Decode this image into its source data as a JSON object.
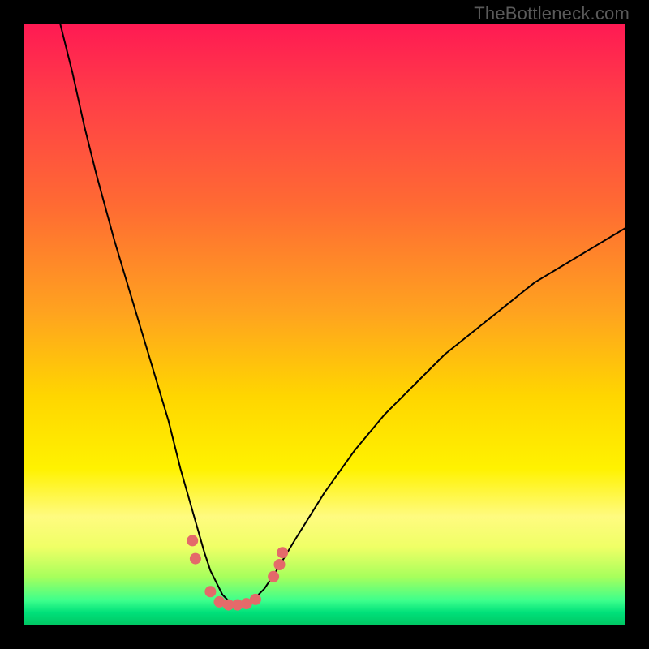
{
  "watermark": "TheBottleneck.com",
  "chart_data": {
    "type": "line",
    "title": "",
    "xlabel": "",
    "ylabel": "",
    "xlim": [
      0,
      100
    ],
    "ylim": [
      0,
      100
    ],
    "background_gradient": {
      "direction": "vertical",
      "stops": [
        {
          "pos": 0,
          "color": "#ff1a53"
        },
        {
          "pos": 12,
          "color": "#ff3d48"
        },
        {
          "pos": 30,
          "color": "#ff6a33"
        },
        {
          "pos": 48,
          "color": "#ffa31f"
        },
        {
          "pos": 62,
          "color": "#ffd600"
        },
        {
          "pos": 74,
          "color": "#fff200"
        },
        {
          "pos": 82,
          "color": "#fffb80"
        },
        {
          "pos": 87,
          "color": "#f0ff66"
        },
        {
          "pos": 92,
          "color": "#a8ff5c"
        },
        {
          "pos": 96,
          "color": "#3cff8c"
        },
        {
          "pos": 98,
          "color": "#00e07a"
        },
        {
          "pos": 100,
          "color": "#00c864"
        }
      ]
    },
    "series": [
      {
        "name": "bottleneck-curve",
        "color": "#000000",
        "stroke_width": 2,
        "x": [
          6,
          8,
          10,
          12,
          15,
          18,
          21,
          24,
          26,
          28,
          30,
          31,
          32,
          33,
          34,
          35,
          36,
          37,
          38,
          40,
          42,
          45,
          50,
          55,
          60,
          65,
          70,
          75,
          80,
          85,
          90,
          95,
          100
        ],
        "y": [
          100,
          92,
          83,
          75,
          64,
          54,
          44,
          34,
          26,
          19,
          12,
          9,
          7,
          5,
          4,
          3.5,
          3.3,
          3.5,
          4,
          6,
          9,
          14,
          22,
          29,
          35,
          40,
          45,
          49,
          53,
          57,
          60,
          63,
          66
        ]
      }
    ],
    "markers": {
      "color": "#e46a6a",
      "radius_px": 7,
      "points": [
        {
          "x": 28,
          "y": 14
        },
        {
          "x": 28.5,
          "y": 11
        },
        {
          "x": 31,
          "y": 5.5
        },
        {
          "x": 32.5,
          "y": 3.8
        },
        {
          "x": 34,
          "y": 3.3
        },
        {
          "x": 35.5,
          "y": 3.3
        },
        {
          "x": 37,
          "y": 3.5
        },
        {
          "x": 38.5,
          "y": 4.2
        },
        {
          "x": 41.5,
          "y": 8
        },
        {
          "x": 42.5,
          "y": 10
        },
        {
          "x": 43,
          "y": 12
        }
      ]
    }
  }
}
